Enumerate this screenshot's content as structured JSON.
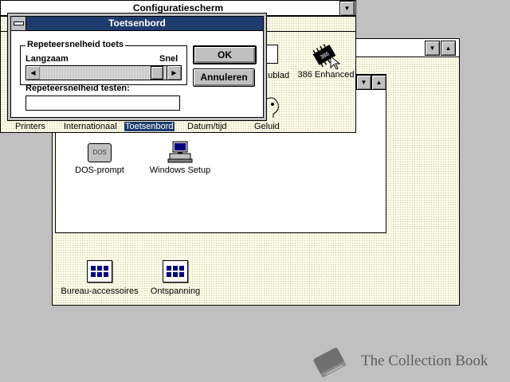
{
  "program_manager": {
    "group_windows": {
      "accessories": {
        "label": "Bureau-accessoires"
      },
      "games": {
        "label": "Ontspanning"
      }
    }
  },
  "main_group": {
    "icons": [
      {
        "label": "DOS-prompt",
        "badge": "DOS"
      },
      {
        "label": "Windows Setup"
      }
    ]
  },
  "control_panel": {
    "title": "Configuratiescherm",
    "icons": [
      {
        "label": "Printers"
      },
      {
        "label": "Internationaal"
      },
      {
        "label": "Toetsenbord"
      },
      {
        "label": "Datum/tijd"
      },
      {
        "label": "Geluid"
      },
      {
        "label": "...ublad"
      },
      {
        "label": "386 Enhanced",
        "badge": "386"
      }
    ]
  },
  "keyboard_dialog": {
    "title": "Toetsenbord",
    "group_label": "Repeteersnelheid toets",
    "slow_label": "Langzaam",
    "fast_label": "Snel",
    "test_label": "Repeteersnelheid testen:",
    "test_value": "",
    "repeat_rate_level": 0.97,
    "ok_label": "OK",
    "cancel_label": "Annuleren"
  },
  "watermark": {
    "text": "The Collection Book"
  }
}
